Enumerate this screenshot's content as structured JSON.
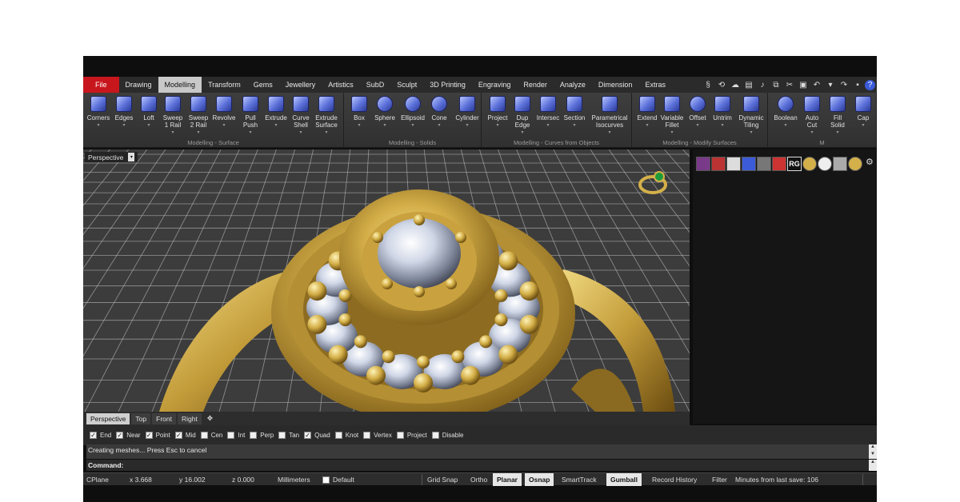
{
  "tabs": [
    "File",
    "Drawing",
    "Modelling",
    "Transform",
    "Gems",
    "Jewellery",
    "Artistics",
    "SubD",
    "Sculpt",
    "3D Printing",
    "Engraving",
    "Render",
    "Analyze",
    "Dimension",
    "Extras"
  ],
  "active_tab": "Modelling",
  "quick_access_icons": [
    "logo-icon",
    "link-icon",
    "cloud-icon",
    "film-icon",
    "microphone-icon",
    "copy-icon",
    "cut-icon",
    "paste-icon",
    "undo-icon",
    "dropdown-icon",
    "redo-icon",
    "save-icon",
    "help-icon"
  ],
  "ribbon": {
    "groups": [
      {
        "title": "Modelling - Surface",
        "tools": [
          {
            "label": "Corners"
          },
          {
            "label": "Edges"
          },
          {
            "label": "Loft"
          },
          {
            "label": "Sweep\n1 Rail"
          },
          {
            "label": "Sweep\n2 Rail"
          },
          {
            "label": "Revolve"
          },
          {
            "label": "Pull\nPush"
          },
          {
            "label": "Extrude"
          },
          {
            "label": "Curve\nShell"
          },
          {
            "label": "Extrude\nSurface"
          }
        ]
      },
      {
        "title": "Modelling - Solids",
        "tools": [
          {
            "label": "Box"
          },
          {
            "label": "Sphere"
          },
          {
            "label": "Ellipsoid"
          },
          {
            "label": "Cone"
          },
          {
            "label": "Cylinder"
          }
        ]
      },
      {
        "title": "Modelling - Curves from Objects",
        "tools": [
          {
            "label": "Project"
          },
          {
            "label": "Dup\nEdge"
          },
          {
            "label": "Intersec"
          },
          {
            "label": "Section"
          },
          {
            "label": "Parametrical\nIsocurves"
          }
        ]
      },
      {
        "title": "Modelling - Modify Surfaces",
        "tools": [
          {
            "label": "Extend"
          },
          {
            "label": "Variable\nFillet"
          },
          {
            "label": "Offset"
          },
          {
            "label": "Untrim"
          },
          {
            "label": "Dynamic\nTiling"
          }
        ]
      },
      {
        "title": "M",
        "tools": [
          {
            "label": "Boolean"
          },
          {
            "label": "Auto\nCut"
          },
          {
            "label": "Fill\nSolid"
          },
          {
            "label": "Cap"
          }
        ]
      }
    ]
  },
  "viewport": {
    "title": "Perspective",
    "grid_color": "#b8b8b8",
    "background": "#3c3c3c"
  },
  "right_panel": {
    "rg_label": "RG"
  },
  "view_tabs": [
    "Perspective",
    "Top",
    "Front",
    "Right"
  ],
  "active_view_tab": "Perspective",
  "osnaps": [
    {
      "label": "End",
      "checked": true
    },
    {
      "label": "Near",
      "checked": true
    },
    {
      "label": "Point",
      "checked": true
    },
    {
      "label": "Mid",
      "checked": true
    },
    {
      "label": "Cen",
      "checked": false
    },
    {
      "label": "Int",
      "checked": false
    },
    {
      "label": "Perp",
      "checked": false
    },
    {
      "label": "Tan",
      "checked": false
    },
    {
      "label": "Quad",
      "checked": true
    },
    {
      "label": "Knot",
      "checked": false
    },
    {
      "label": "Vertex",
      "checked": false
    },
    {
      "label": "Project",
      "checked": false
    },
    {
      "label": "Disable",
      "checked": false
    }
  ],
  "command_history": "Creating meshes... Press Esc to cancel",
  "command_prompt": "Command:",
  "status": {
    "cplane": "CPlane",
    "x": "x 3.668",
    "y": "y 16.002",
    "z": "z 0.000",
    "units": "Millimeters",
    "layer": "Default",
    "grid_snap": "Grid Snap",
    "ortho": "Ortho",
    "planar": "Planar",
    "osnap": "Osnap",
    "smarttrack": "SmartTrack",
    "gumball": "Gumball",
    "record_history": "Record History",
    "filter": "Filter",
    "last_save": "Minutes from last save: 106"
  },
  "colors": {
    "file_tab": "#c8161d",
    "gold": "#d4b04a",
    "accent_icon": "#5a6fd8"
  }
}
